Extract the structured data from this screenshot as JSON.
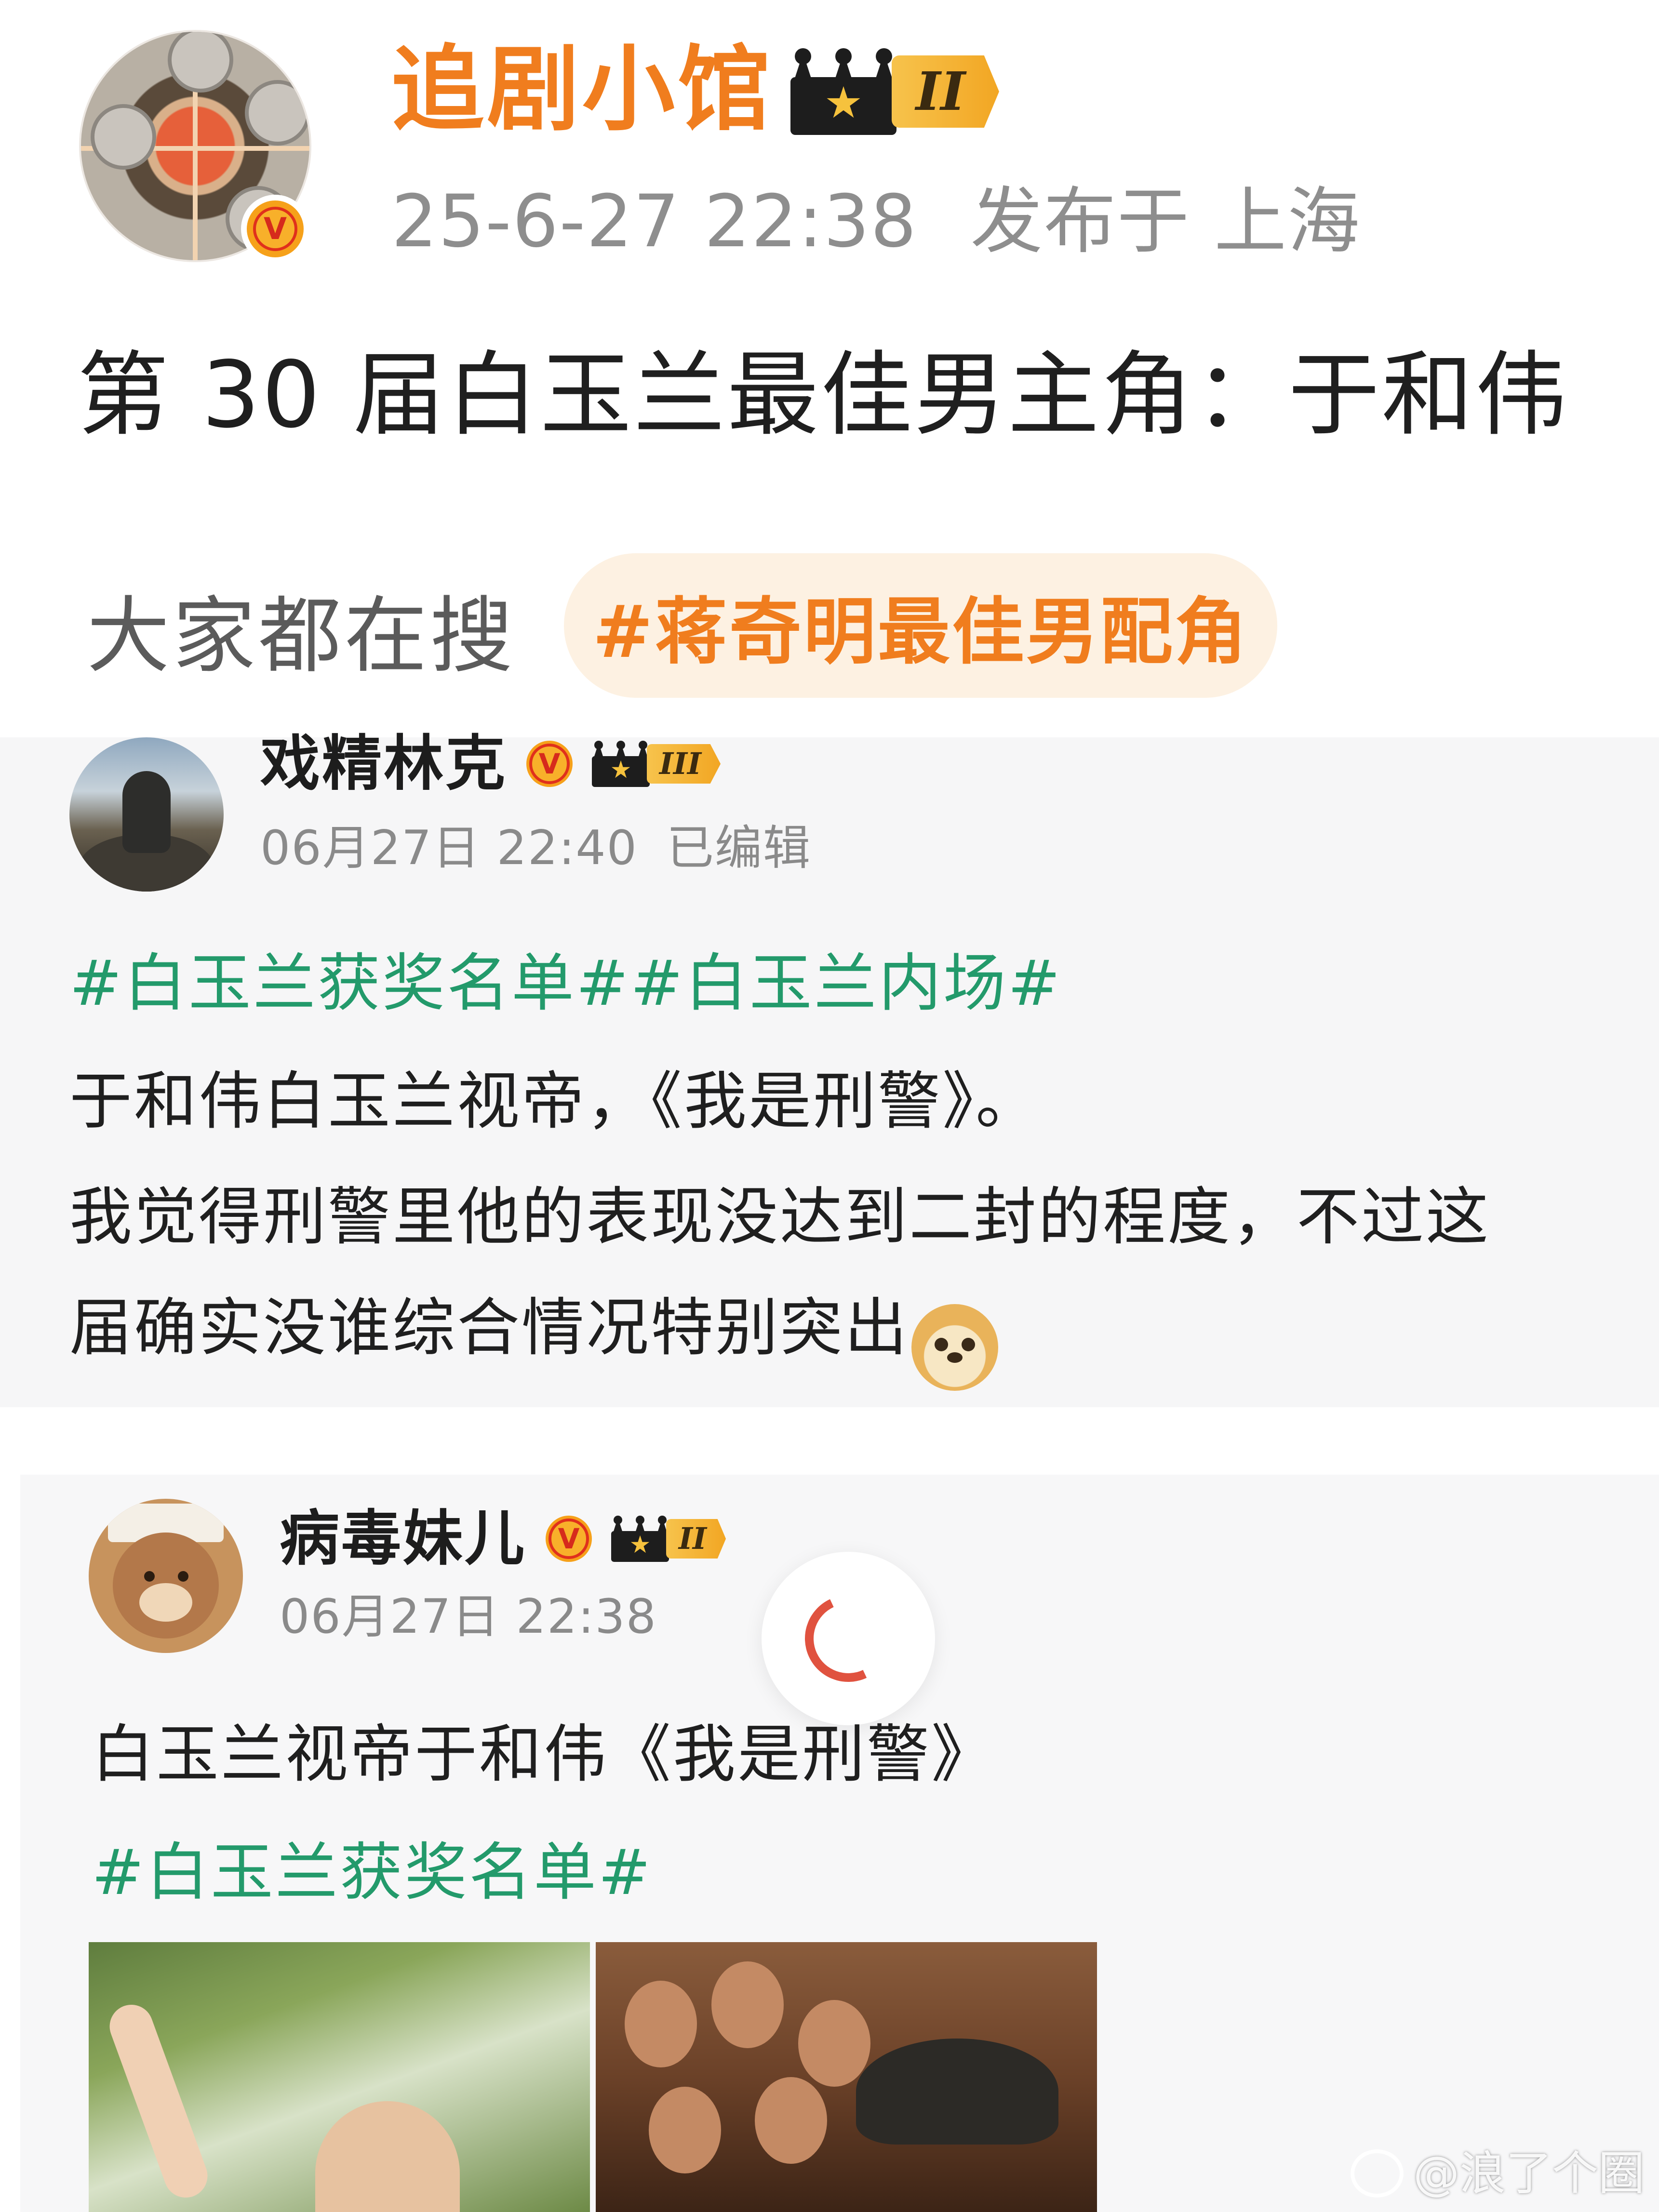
{
  "main_post": {
    "username": "追剧小馆",
    "vip_level": "II",
    "timestamp": "25-6-27 22:38",
    "location": "发布于 上海",
    "text": "第 30 届白玉兰最佳男主角：于和伟"
  },
  "search_row": {
    "label": "大家都在搜",
    "chip": "#蒋奇明最佳男配角"
  },
  "comments": [
    {
      "username": "戏精林克",
      "vip_level": "III",
      "date": "06月27日 22:40",
      "edited": "已编辑",
      "hashtags": "#白玉兰获奖名单##白玉兰内场#",
      "lines": [
        "于和伟白玉兰视帝，《我是刑警》。",
        "我觉得刑警里他的表现没达到二封的程度，不过这",
        "届确实没谁综合情况特别突出"
      ]
    },
    {
      "username": "病毒妹儿",
      "vip_level": "II",
      "date": "06月27日 22:38",
      "text": "白玉兰视帝于和伟《我是刑警》",
      "hashtags": "#白玉兰获奖名单#"
    }
  ],
  "verified_mark": "V",
  "watermark": "@浪了个圈",
  "colors": {
    "username_orange": "#f07d1e",
    "hashtag_green": "#239a6b",
    "verified_orange": "#f6a11a",
    "loading_red": "#e0523f"
  },
  "icons": [
    "verified-icon",
    "crown-icon",
    "doge-emoji-icon",
    "loading-spinner-icon",
    "weibo-logo-icon"
  ]
}
